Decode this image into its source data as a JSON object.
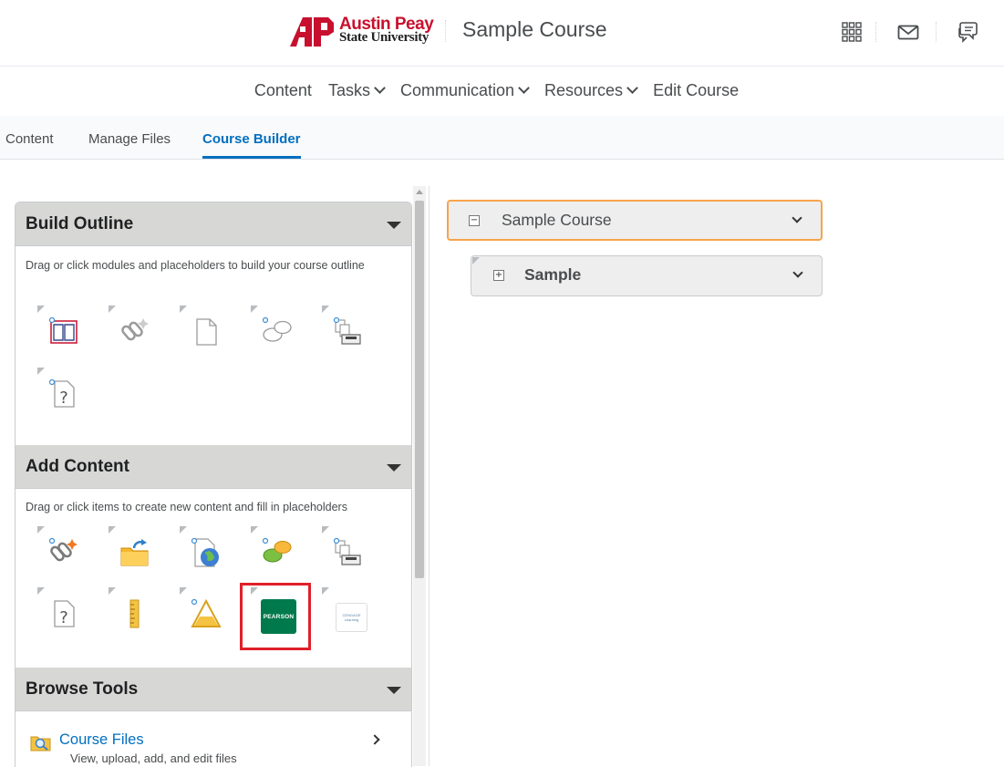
{
  "header": {
    "logo_line1": "Austin Peay",
    "logo_line2": "State University",
    "course_title": "Sample Course",
    "icons": [
      "waffle-grid-icon",
      "envelope-icon",
      "chat-bubbles-icon"
    ]
  },
  "nav": {
    "items": [
      {
        "label": "Content",
        "has_menu": false
      },
      {
        "label": "Tasks",
        "has_menu": true
      },
      {
        "label": "Communication",
        "has_menu": true
      },
      {
        "label": "Resources",
        "has_menu": true
      },
      {
        "label": "Edit Course",
        "has_menu": false
      }
    ]
  },
  "tabs": {
    "items": [
      "Content",
      "Manage Files",
      "Course Builder"
    ],
    "active": "Course Builder"
  },
  "build_outline": {
    "title": "Build Outline",
    "description": "Drag or click modules and placeholders to build your course outline",
    "tools": [
      "module-book-icon",
      "link-placeholder-icon",
      "file-placeholder-icon",
      "discussion-placeholder-icon",
      "dropbox-placeholder-icon",
      "quiz-placeholder-icon"
    ]
  },
  "add_content": {
    "title": "Add Content",
    "description": "Drag or click items to create new content and fill in placeholders",
    "tools": [
      "new-link-icon",
      "upload-files-icon",
      "web-page-icon",
      "discussion-icon",
      "dropbox-icon",
      "quiz-icon",
      "grade-item-icon",
      "survey-icon",
      "pearson-icon",
      "cengage-icon"
    ],
    "pearson_label": "PEARSON",
    "cengage_label": "CENGAGE Learning"
  },
  "browse_tools": {
    "title": "Browse Tools",
    "item_label": "Course Files",
    "item_sub": "View, upload, add, and edit files"
  },
  "outline": {
    "root_label": "Sample Course",
    "child_label": "Sample"
  },
  "colors": {
    "accent": "#006fbf",
    "brand_red": "#c8102e",
    "highlight": "#e0202a",
    "pearson_green": "#007a4d",
    "selected_border": "#f7a44b"
  }
}
